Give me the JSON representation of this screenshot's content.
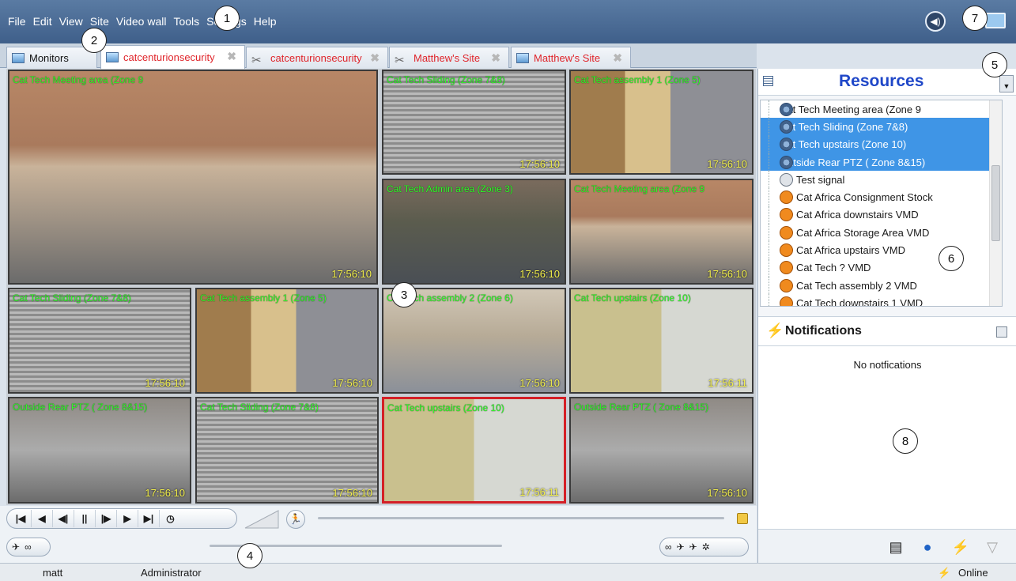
{
  "menu": [
    "File",
    "Edit",
    "View",
    "Site",
    "Video wall",
    "Tools",
    "Settings",
    "Help"
  ],
  "callouts": [
    "1",
    "2",
    "3",
    "4",
    "5",
    "6",
    "7",
    "8"
  ],
  "tabs": [
    {
      "label": "Monitors",
      "icon": "monitor-icon",
      "color": "black"
    },
    {
      "label": "catcenturionsecurity",
      "icon": "site-icon",
      "active": true
    },
    {
      "label": "catcenturionsecurity",
      "icon": "network-icon"
    },
    {
      "label": "Matthew's Site",
      "icon": "network-icon"
    },
    {
      "label": "Matthew's Site",
      "icon": "site-icon"
    }
  ],
  "cameras": [
    {
      "title": "Cat Tech Meeting area (Zone 9",
      "time": "17:56:10"
    },
    {
      "title": "Cat Tech Sliding (Zone 7&8)",
      "time": "17:56:10"
    },
    {
      "title": "Cat Tech assembly 1 (Zone 5)",
      "time": "17:56:10"
    },
    {
      "title": "Cat Tech Admin area (Zone 3)",
      "time": "17:56:10"
    },
    {
      "title": "Cat Tech Meeting area (Zone 9",
      "time": "17:56:10"
    },
    {
      "title": "Cat Tech Sliding (Zone 7&8)",
      "time": "17:56:10"
    },
    {
      "title": "Cat Tech assembly 1 (Zone 5)",
      "time": "17:56:10"
    },
    {
      "title": "Cat Tech assembly 2 (Zone 6)",
      "time": "17:56:10"
    },
    {
      "title": "Cat Tech upstairs (Zone 10)",
      "time": "17:56:11"
    },
    {
      "title": "Outside Rear PTZ ( Zone 8&15)",
      "time": "17:56:10"
    },
    {
      "title": "Cat Tech Sliding (Zone 7&8)",
      "time": "17:56:10"
    },
    {
      "title": "Cat Tech upstairs (Zone 10)",
      "time": "17:56:11"
    },
    {
      "title": "Outside Rear PTZ ( Zone 8&15)",
      "time": "17:56:10"
    }
  ],
  "playback": [
    "first-icon",
    "prev-icon",
    "step-back-icon",
    "pause-icon",
    "step-fwd-icon",
    "play-icon",
    "last-icon",
    "clock-icon"
  ],
  "resources": {
    "title": "Resources",
    "items": [
      {
        "label": "Cat Tech Meeting area (Zone 9",
        "type": "cam",
        "selected": false
      },
      {
        "label": "Cat Tech Sliding (Zone 7&8)",
        "type": "cam",
        "selected": true
      },
      {
        "label": "Cat Tech upstairs  (Zone 10)",
        "type": "cam",
        "selected": true
      },
      {
        "label": "Outside Rear PTZ ( Zone 8&15)",
        "type": "cam",
        "selected": true
      },
      {
        "label": "Test signal",
        "type": "mic",
        "selected": false
      },
      {
        "label": "Cat Africa Consignment Stock",
        "type": "vmd",
        "selected": false
      },
      {
        "label": "Cat Africa downstairs VMD",
        "type": "vmd",
        "selected": false
      },
      {
        "label": "Cat Africa Storage Area VMD",
        "type": "vmd",
        "selected": false
      },
      {
        "label": "Cat Africa upstairs VMD",
        "type": "vmd",
        "selected": false
      },
      {
        "label": "Cat Tech ? VMD",
        "type": "vmd",
        "selected": false
      },
      {
        "label": "Cat Tech assembly 2 VMD",
        "type": "vmd",
        "selected": false
      },
      {
        "label": "Cat Tech downstairs 1 VMD",
        "type": "vmd",
        "selected": false
      }
    ]
  },
  "notifications": {
    "title": "Notifications",
    "empty": "No notfications"
  },
  "status": {
    "user": "matt",
    "role": "Administrator",
    "connection": "Online"
  }
}
